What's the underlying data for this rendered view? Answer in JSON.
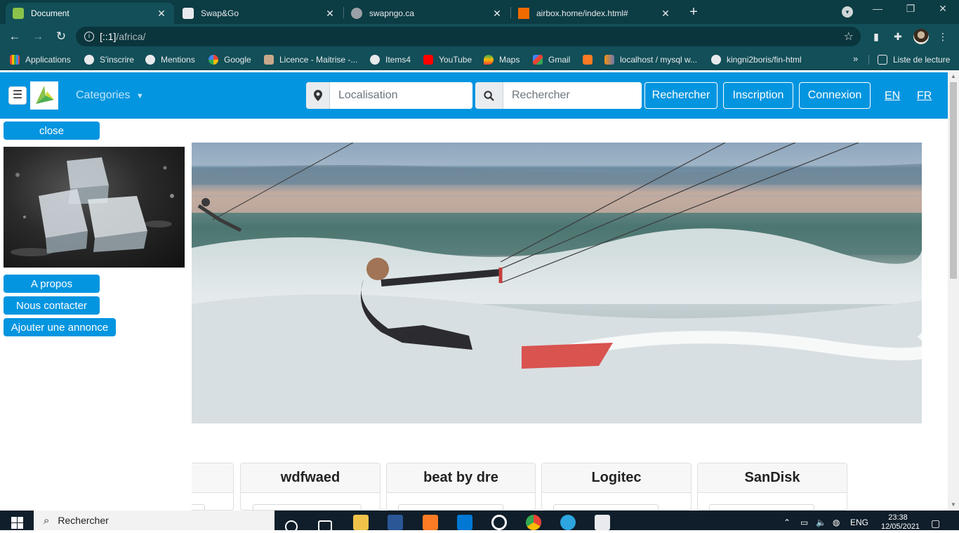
{
  "browser": {
    "tabs": [
      {
        "title": "Document",
        "active": true
      },
      {
        "title": "Swap&Go",
        "active": false
      },
      {
        "title": "swapngo.ca",
        "active": false
      },
      {
        "title": "airbox.home/index.html#",
        "active": false
      }
    ],
    "url_host": "[::1]",
    "url_path": "/africa/",
    "bookmarks": [
      "Applications",
      "S'inscrire",
      "Mentions",
      "Google",
      "Licence - Maitrise -...",
      "Items4",
      "YouTube",
      "Maps",
      "Gmail",
      "localhost / mysql w...",
      "kingni2boris/fin-html"
    ],
    "reading_list": "Liste de lecture",
    "more_bookmarks": "»"
  },
  "site": {
    "categories": "Categories",
    "location_placeholder": "Localisation",
    "search_placeholder": "Rechercher",
    "search_button": "Rechercher",
    "signup_button": "Inscription",
    "login_button": "Connexion",
    "lang_en": "EN",
    "lang_fr": "FR"
  },
  "sidebar": {
    "close": "close",
    "about": "A propos",
    "contact": "Nous contacter",
    "add_listing": "Ajouter une annonce"
  },
  "cards": [
    "wdfwaed",
    "beat by dre",
    "Logitec",
    "SanDisk"
  ],
  "taskbar": {
    "search_placeholder": "Rechercher",
    "language": "ENG",
    "time": "23:38",
    "date": "12/05/2021"
  },
  "colors": {
    "chrome_dark": "#0c3c44",
    "chrome_toolbar": "#124f58",
    "site_blue": "#0495e0"
  }
}
